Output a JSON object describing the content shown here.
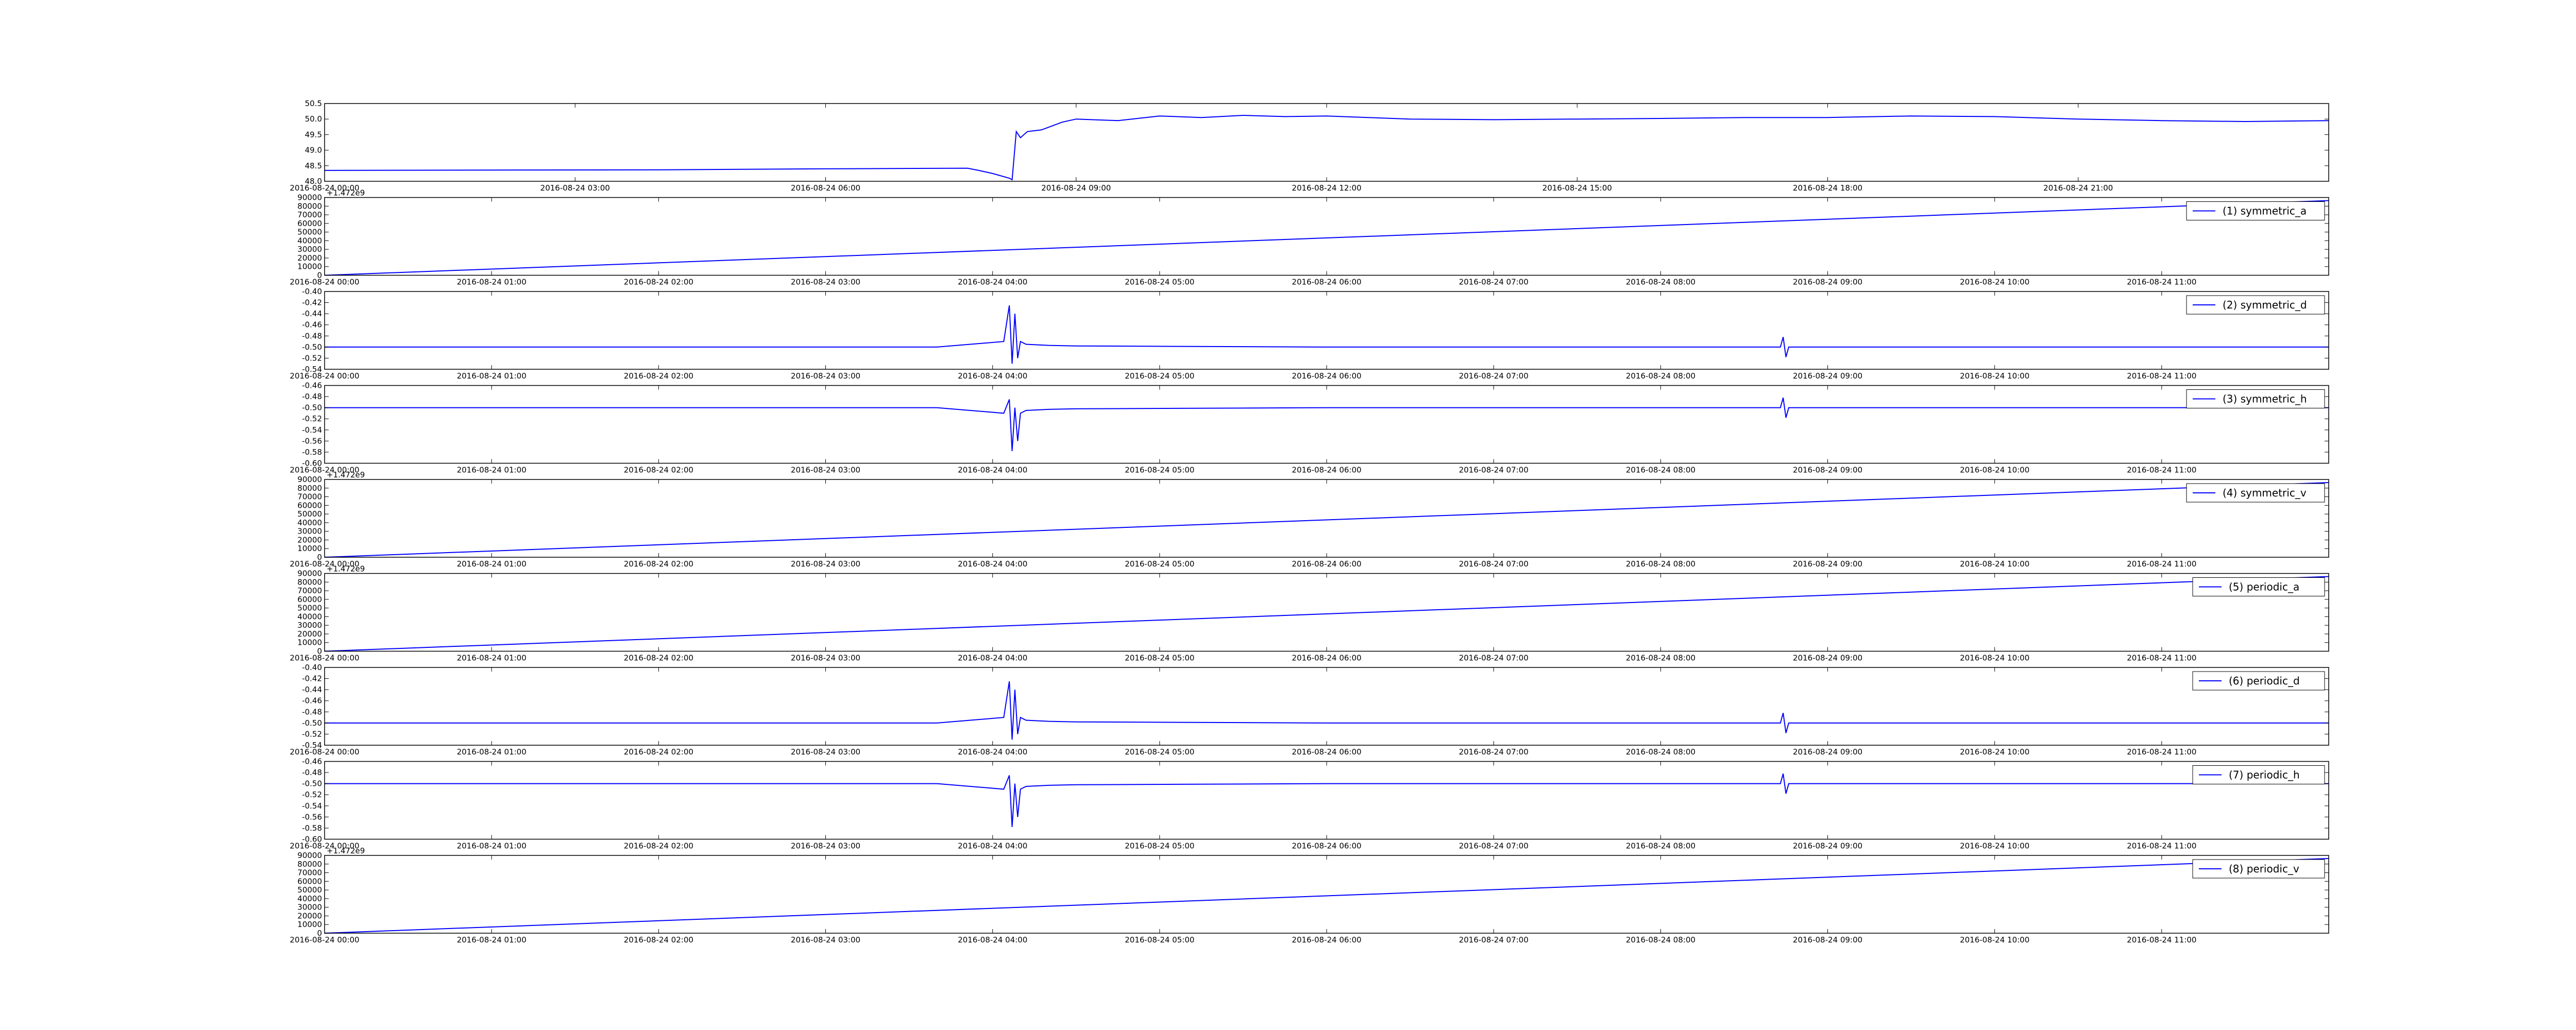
{
  "colors": {
    "line": "#0000ff",
    "axes": "#000000",
    "background": "#ffffff"
  },
  "chart_data": [
    {
      "type": "line",
      "title": "",
      "xlabel": "",
      "ylabel": "",
      "grid": false,
      "legend": "none",
      "xlim": [
        "2016-08-24 00:00",
        "2016-08-25 00:00"
      ],
      "ylim": [
        48.0,
        50.5
      ],
      "yticks": [
        "48.0",
        "48.5",
        "49.0",
        "49.5",
        "50.0",
        "50.5"
      ],
      "xticks": [
        "2016-08-24 00:00",
        "2016-08-24 03:00",
        "2016-08-24 06:00",
        "2016-08-24 09:00",
        "2016-08-24 12:00",
        "2016-08-24 15:00",
        "2016-08-24 18:00",
        "2016-08-24 21:00"
      ],
      "series": [
        {
          "x": [
            "2016-08-24 00:00",
            "2016-08-24 02:00",
            "2016-08-24 04:00",
            "2016-08-24 06:00",
            "2016-08-24 07:42",
            "2016-08-24 07:50",
            "2016-08-24 08:00",
            "2016-08-24 08:12",
            "2016-08-24 08:14",
            "2016-08-24 08:17",
            "2016-08-24 08:20",
            "2016-08-24 08:25",
            "2016-08-24 08:35",
            "2016-08-24 08:50",
            "2016-08-24 09:00",
            "2016-08-24 09:30",
            "2016-08-24 10:00",
            "2016-08-24 10:30",
            "2016-08-24 11:00",
            "2016-08-24 11:30",
            "2016-08-24 12:00",
            "2016-08-24 12:30",
            "2016-08-24 13:00",
            "2016-08-24 14:00",
            "2016-08-24 15:00",
            "2016-08-24 16:00",
            "2016-08-24 17:00",
            "2016-08-24 18:00",
            "2016-08-24 19:00",
            "2016-08-24 20:00",
            "2016-08-24 21:00",
            "2016-08-24 22:00",
            "2016-08-24 23:00",
            "2016-08-25 00:00"
          ],
          "values": [
            48.35,
            48.36,
            48.37,
            48.4,
            48.42,
            48.35,
            48.25,
            48.1,
            48.05,
            49.6,
            49.4,
            49.6,
            49.65,
            49.9,
            50.0,
            49.95,
            50.1,
            50.05,
            50.12,
            50.08,
            50.1,
            50.05,
            50.0,
            49.98,
            50.0,
            50.02,
            50.05,
            50.05,
            50.1,
            50.08,
            50.0,
            49.95,
            49.92,
            49.95
          ]
        }
      ]
    },
    {
      "type": "line",
      "title": "",
      "xlabel": "",
      "ylabel": "",
      "grid": false,
      "legend": "top-right",
      "offset": "+1.472e9",
      "xlim": [
        "2016-08-24 00:00",
        "2016-08-24 12:00"
      ],
      "ylim": [
        0,
        90000
      ],
      "yticks": [
        "0",
        "10000",
        "20000",
        "30000",
        "40000",
        "50000",
        "60000",
        "70000",
        "80000",
        "90000"
      ],
      "xticks": [
        "2016-08-24 00:00",
        "2016-08-24 01:00",
        "2016-08-24 02:00",
        "2016-08-24 03:00",
        "2016-08-24 04:00",
        "2016-08-24 05:00",
        "2016-08-24 06:00",
        "2016-08-24 07:00",
        "2016-08-24 08:00",
        "2016-08-24 09:00",
        "2016-08-24 10:00",
        "2016-08-24 11:00"
      ],
      "series": [
        {
          "name": "(1) symmetric_a",
          "x": [
            "2016-08-24 00:00",
            "2016-08-24 12:00"
          ],
          "values": [
            0,
            86400
          ]
        }
      ]
    },
    {
      "type": "line",
      "title": "",
      "xlabel": "",
      "ylabel": "",
      "grid": false,
      "legend": "top-right",
      "xlim": [
        "2016-08-24 00:00",
        "2016-08-24 12:00"
      ],
      "ylim": [
        -0.54,
        -0.4
      ],
      "yticks": [
        "-0.54",
        "-0.52",
        "-0.50",
        "-0.48",
        "-0.46",
        "-0.44",
        "-0.42",
        "-0.40"
      ],
      "xticks": [
        "2016-08-24 00:00",
        "2016-08-24 01:00",
        "2016-08-24 02:00",
        "2016-08-24 03:00",
        "2016-08-24 04:00",
        "2016-08-24 05:00",
        "2016-08-24 06:00",
        "2016-08-24 07:00",
        "2016-08-24 08:00",
        "2016-08-24 09:00",
        "2016-08-24 10:00",
        "2016-08-24 11:00"
      ],
      "series": [
        {
          "name": "(2) symmetric_d",
          "x": [
            "2016-08-24 00:00",
            "2016-08-24 03:40",
            "2016-08-24 04:04",
            "2016-08-24 04:06",
            "2016-08-24 04:07",
            "2016-08-24 04:08",
            "2016-08-24 04:09",
            "2016-08-24 04:10",
            "2016-08-24 04:12",
            "2016-08-24 04:20",
            "2016-08-24 04:30",
            "2016-08-24 06:00",
            "2016-08-24 08:43",
            "2016-08-24 08:44",
            "2016-08-24 08:45",
            "2016-08-24 08:46",
            "2016-08-24 12:00"
          ],
          "values": [
            -0.5,
            -0.5,
            -0.49,
            -0.425,
            -0.53,
            -0.44,
            -0.52,
            -0.49,
            -0.495,
            -0.497,
            -0.498,
            -0.5,
            -0.5,
            -0.482,
            -0.518,
            -0.5,
            -0.5
          ]
        }
      ]
    },
    {
      "type": "line",
      "title": "",
      "xlabel": "",
      "ylabel": "",
      "grid": false,
      "legend": "top-right",
      "xlim": [
        "2016-08-24 00:00",
        "2016-08-24 12:00"
      ],
      "ylim": [
        -0.6,
        -0.46
      ],
      "yticks": [
        "-0.60",
        "-0.58",
        "-0.56",
        "-0.54",
        "-0.52",
        "-0.50",
        "-0.48",
        "-0.46"
      ],
      "xticks": [
        "2016-08-24 00:00",
        "2016-08-24 01:00",
        "2016-08-24 02:00",
        "2016-08-24 03:00",
        "2016-08-24 04:00",
        "2016-08-24 05:00",
        "2016-08-24 06:00",
        "2016-08-24 07:00",
        "2016-08-24 08:00",
        "2016-08-24 09:00",
        "2016-08-24 10:00",
        "2016-08-24 11:00"
      ],
      "series": [
        {
          "name": "(3) symmetric_h",
          "x": [
            "2016-08-24 00:00",
            "2016-08-24 03:40",
            "2016-08-24 04:04",
            "2016-08-24 04:06",
            "2016-08-24 04:07",
            "2016-08-24 04:08",
            "2016-08-24 04:09",
            "2016-08-24 04:10",
            "2016-08-24 04:12",
            "2016-08-24 04:20",
            "2016-08-24 04:30",
            "2016-08-24 06:00",
            "2016-08-24 08:43",
            "2016-08-24 08:44",
            "2016-08-24 08:45",
            "2016-08-24 08:46",
            "2016-08-24 12:00"
          ],
          "values": [
            -0.5,
            -0.5,
            -0.51,
            -0.485,
            -0.578,
            -0.5,
            -0.56,
            -0.51,
            -0.505,
            -0.503,
            -0.502,
            -0.5,
            -0.5,
            -0.482,
            -0.518,
            -0.5,
            -0.5
          ]
        }
      ]
    },
    {
      "type": "line",
      "title": "",
      "xlabel": "",
      "ylabel": "",
      "grid": false,
      "legend": "top-right",
      "offset": "+1.472e9",
      "xlim": [
        "2016-08-24 00:00",
        "2016-08-24 12:00"
      ],
      "ylim": [
        0,
        90000
      ],
      "yticks": [
        "0",
        "10000",
        "20000",
        "30000",
        "40000",
        "50000",
        "60000",
        "70000",
        "80000",
        "90000"
      ],
      "xticks": [
        "2016-08-24 00:00",
        "2016-08-24 01:00",
        "2016-08-24 02:00",
        "2016-08-24 03:00",
        "2016-08-24 04:00",
        "2016-08-24 05:00",
        "2016-08-24 06:00",
        "2016-08-24 07:00",
        "2016-08-24 08:00",
        "2016-08-24 09:00",
        "2016-08-24 10:00",
        "2016-08-24 11:00"
      ],
      "series": [
        {
          "name": "(4) symmetric_v",
          "x": [
            "2016-08-24 00:00",
            "2016-08-24 12:00"
          ],
          "values": [
            0,
            86400
          ]
        }
      ]
    },
    {
      "type": "line",
      "title": "",
      "xlabel": "",
      "ylabel": "",
      "grid": false,
      "legend": "top-right",
      "offset": "+1.472e9",
      "xlim": [
        "2016-08-24 00:00",
        "2016-08-24 12:00"
      ],
      "ylim": [
        0,
        90000
      ],
      "yticks": [
        "0",
        "10000",
        "20000",
        "30000",
        "40000",
        "50000",
        "60000",
        "70000",
        "80000",
        "90000"
      ],
      "xticks": [
        "2016-08-24 00:00",
        "2016-08-24 01:00",
        "2016-08-24 02:00",
        "2016-08-24 03:00",
        "2016-08-24 04:00",
        "2016-08-24 05:00",
        "2016-08-24 06:00",
        "2016-08-24 07:00",
        "2016-08-24 08:00",
        "2016-08-24 09:00",
        "2016-08-24 10:00",
        "2016-08-24 11:00"
      ],
      "series": [
        {
          "name": "(5) periodic_a",
          "x": [
            "2016-08-24 00:00",
            "2016-08-24 12:00"
          ],
          "values": [
            0,
            86400
          ]
        }
      ]
    },
    {
      "type": "line",
      "title": "",
      "xlabel": "",
      "ylabel": "",
      "grid": false,
      "legend": "top-right",
      "xlim": [
        "2016-08-24 00:00",
        "2016-08-24 12:00"
      ],
      "ylim": [
        -0.54,
        -0.4
      ],
      "yticks": [
        "-0.54",
        "-0.52",
        "-0.50",
        "-0.48",
        "-0.46",
        "-0.44",
        "-0.42",
        "-0.40"
      ],
      "xticks": [
        "2016-08-24 00:00",
        "2016-08-24 01:00",
        "2016-08-24 02:00",
        "2016-08-24 03:00",
        "2016-08-24 04:00",
        "2016-08-24 05:00",
        "2016-08-24 06:00",
        "2016-08-24 07:00",
        "2016-08-24 08:00",
        "2016-08-24 09:00",
        "2016-08-24 10:00",
        "2016-08-24 11:00"
      ],
      "series": [
        {
          "name": "(6) periodic_d",
          "x": [
            "2016-08-24 00:00",
            "2016-08-24 03:40",
            "2016-08-24 04:04",
            "2016-08-24 04:06",
            "2016-08-24 04:07",
            "2016-08-24 04:08",
            "2016-08-24 04:09",
            "2016-08-24 04:10",
            "2016-08-24 04:12",
            "2016-08-24 04:20",
            "2016-08-24 04:30",
            "2016-08-24 06:00",
            "2016-08-24 08:43",
            "2016-08-24 08:44",
            "2016-08-24 08:45",
            "2016-08-24 08:46",
            "2016-08-24 12:00"
          ],
          "values": [
            -0.5,
            -0.5,
            -0.49,
            -0.425,
            -0.53,
            -0.44,
            -0.52,
            -0.49,
            -0.495,
            -0.497,
            -0.498,
            -0.5,
            -0.5,
            -0.482,
            -0.518,
            -0.5,
            -0.5
          ]
        }
      ]
    },
    {
      "type": "line",
      "title": "",
      "xlabel": "",
      "ylabel": "",
      "grid": false,
      "legend": "top-right",
      "xlim": [
        "2016-08-24 00:00",
        "2016-08-24 12:00"
      ],
      "ylim": [
        -0.6,
        -0.46
      ],
      "yticks": [
        "-0.60",
        "-0.58",
        "-0.56",
        "-0.54",
        "-0.52",
        "-0.50",
        "-0.48",
        "-0.46"
      ],
      "xticks": [
        "2016-08-24 00:00",
        "2016-08-24 01:00",
        "2016-08-24 02:00",
        "2016-08-24 03:00",
        "2016-08-24 04:00",
        "2016-08-24 05:00",
        "2016-08-24 06:00",
        "2016-08-24 07:00",
        "2016-08-24 08:00",
        "2016-08-24 09:00",
        "2016-08-24 10:00",
        "2016-08-24 11:00"
      ],
      "series": [
        {
          "name": "(7) periodic_h",
          "x": [
            "2016-08-24 00:00",
            "2016-08-24 03:40",
            "2016-08-24 04:04",
            "2016-08-24 04:06",
            "2016-08-24 04:07",
            "2016-08-24 04:08",
            "2016-08-24 04:09",
            "2016-08-24 04:10",
            "2016-08-24 04:12",
            "2016-08-24 04:20",
            "2016-08-24 04:30",
            "2016-08-24 06:00",
            "2016-08-24 08:43",
            "2016-08-24 08:44",
            "2016-08-24 08:45",
            "2016-08-24 08:46",
            "2016-08-24 12:00"
          ],
          "values": [
            -0.5,
            -0.5,
            -0.51,
            -0.485,
            -0.578,
            -0.5,
            -0.56,
            -0.51,
            -0.505,
            -0.503,
            -0.502,
            -0.5,
            -0.5,
            -0.482,
            -0.518,
            -0.5,
            -0.5
          ]
        }
      ]
    },
    {
      "type": "line",
      "title": "",
      "xlabel": "",
      "ylabel": "",
      "grid": false,
      "legend": "top-right",
      "offset": "+1.472e9",
      "xlim": [
        "2016-08-24 00:00",
        "2016-08-24 12:00"
      ],
      "ylim": [
        0,
        90000
      ],
      "yticks": [
        "0",
        "10000",
        "20000",
        "30000",
        "40000",
        "50000",
        "60000",
        "70000",
        "80000",
        "90000"
      ],
      "xticks": [
        "2016-08-24 00:00",
        "2016-08-24 01:00",
        "2016-08-24 02:00",
        "2016-08-24 03:00",
        "2016-08-24 04:00",
        "2016-08-24 05:00",
        "2016-08-24 06:00",
        "2016-08-24 07:00",
        "2016-08-24 08:00",
        "2016-08-24 09:00",
        "2016-08-24 10:00",
        "2016-08-24 11:00"
      ],
      "series": [
        {
          "name": "(8) periodic_v",
          "x": [
            "2016-08-24 00:00",
            "2016-08-24 12:00"
          ],
          "values": [
            0,
            86400
          ]
        }
      ]
    }
  ]
}
